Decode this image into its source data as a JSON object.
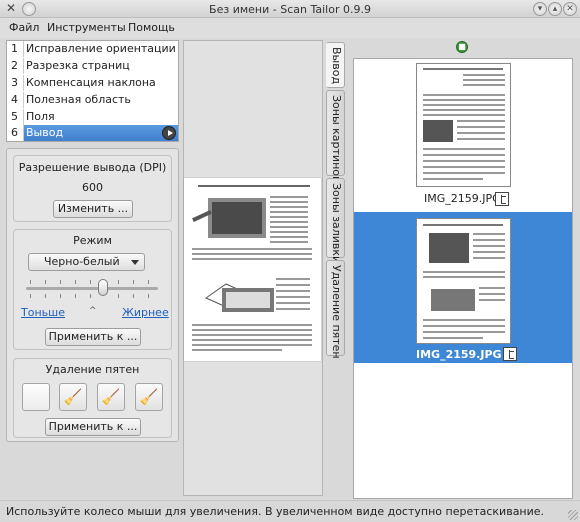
{
  "window": {
    "title": "Без имени - Scan Tailor 0.9.9"
  },
  "menu": {
    "file": "Файл",
    "tools": "Инструменты",
    "help": "Помощь"
  },
  "steps": [
    {
      "num": "1",
      "label": "Исправление ориентации"
    },
    {
      "num": "2",
      "label": "Разрезка страниц"
    },
    {
      "num": "3",
      "label": "Компенсация наклона"
    },
    {
      "num": "4",
      "label": "Полезная область"
    },
    {
      "num": "5",
      "label": "Поля"
    },
    {
      "num": "6",
      "label": "Вывод"
    }
  ],
  "dpi": {
    "title": "Разрешение вывода (DPI)",
    "value": "600",
    "change_label": "Изменить ..."
  },
  "mode": {
    "title": "Режим",
    "selected": "Черно-белый",
    "thinner_label": "Тоньше",
    "thicker_label": "Жирнее",
    "slider_level": 0.58,
    "apply_label": "Применить к ..."
  },
  "despeckle": {
    "title": "Удаление пятен",
    "apply_label": "Применить к ..."
  },
  "view_tabs": [
    "Вывод",
    "Зоны картинок",
    "Зоны заливки",
    "Удаление пятен"
  ],
  "thumbnails": [
    {
      "filename": "IMG_2159.JPG",
      "selected": false
    },
    {
      "filename": "IMG_2159.JPG",
      "selected": true
    }
  ],
  "statusbar": {
    "text": "Используйте колесо мыши для увеличения.  В увеличенном виде доступно перетаскивание."
  },
  "colors": {
    "accent": "#3d87d6",
    "link": "#1f5fbf"
  }
}
